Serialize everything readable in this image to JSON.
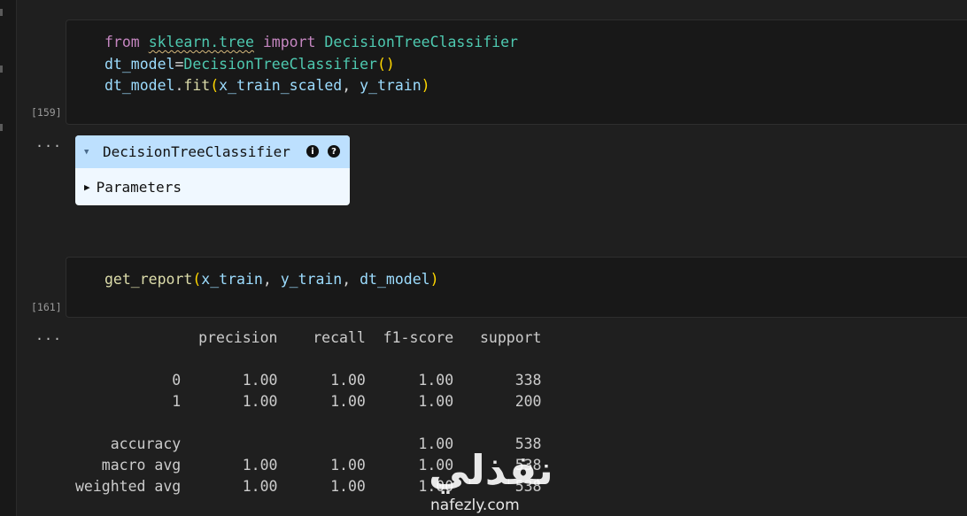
{
  "cell1": {
    "exec_count": "[159]",
    "line1": {
      "kw1": "from",
      "module": "sklearn.tree",
      "kw2": "import",
      "cls": "DecisionTreeClassifier"
    },
    "line2": {
      "var": "dt_model",
      "op": "=",
      "cls": "DecisionTreeClassifier",
      "open": "(",
      "close": ")"
    },
    "line3": {
      "var": "dt_model",
      "dot": ".",
      "fn": "fit",
      "open": "(",
      "arg1": "x_train_scaled",
      "comma": ", ",
      "arg2": "y_train",
      "close": ")"
    }
  },
  "output1": {
    "ellipsis": "...",
    "widget_title": "DecisionTreeClassifier",
    "info_icon": "i",
    "help_icon": "?",
    "collapse_glyph": "▼",
    "parameters_glyph": "▶",
    "parameters_label": "Parameters"
  },
  "cell2": {
    "exec_count": "[161]",
    "line1": {
      "fn": "get_report",
      "open": "(",
      "arg1": "x_train",
      "c1": ", ",
      "arg2": "y_train",
      "c2": ", ",
      "arg3": "dt_model",
      "close": ")"
    }
  },
  "output2": {
    "ellipsis": "...",
    "report_text": "              precision    recall  f1-score   support\n\n           0       1.00      1.00      1.00       338\n           1       1.00      1.00      1.00       200\n\n    accuracy                           1.00       538\n   macro avg       1.00      1.00      1.00       538\nweighted avg       1.00      1.00      1.00       538"
  },
  "watermark": {
    "arabic": "نفذلي",
    "url": "nafezly.com"
  }
}
